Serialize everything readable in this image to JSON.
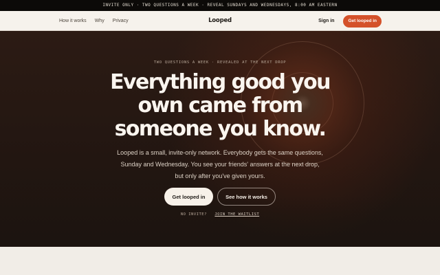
{
  "announcement": "INVITE ONLY · TWO QUESTIONS A WEEK · REVEAL SUNDAYS AND WEDNESDAYS, 8:00 AM EASTERN",
  "nav": {
    "links": [
      "How it works",
      "Why",
      "Privacy"
    ],
    "logo": "Looped",
    "signin": "Sign in",
    "cta": "Get looped in"
  },
  "hero": {
    "eyebrow": "TWO QUESTIONS A WEEK · REVEALED AT THE NEXT DROP",
    "headline_lines": [
      "Everything good you",
      "own came from",
      "someone you know."
    ],
    "subtext": "Looped is a small, invite-only network. Everybody gets the same questions, Sunday and Wednesday. You see your friends' answers at the next drop, but only after you've given yours.",
    "primary_cta": "Get looped in",
    "secondary_cta": "See how it works",
    "no_invite": "NO INVITE?",
    "waitlist": "JOIN THE WAITLIST"
  },
  "colors": {
    "accent": "#d4512a",
    "hero_bg": "#221611",
    "page_bg": "#f1ede7"
  }
}
